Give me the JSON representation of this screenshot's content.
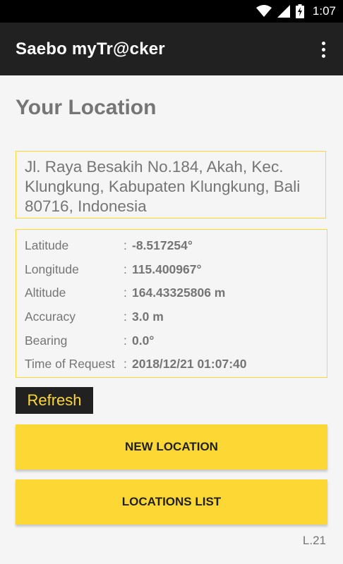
{
  "status_bar": {
    "time": "1:07",
    "icons": [
      "wifi-icon",
      "signal-icon",
      "battery-charging-icon"
    ]
  },
  "app_bar": {
    "title": "Saebo myTr@cker",
    "menu_icon": "overflow-menu-icon"
  },
  "location": {
    "heading": "Your Location",
    "address": "Jl. Raya Besakih No.184, Akah, Kec. Klungkung, Kabupaten Klungkung, Bali 80716, Indonesia",
    "details": [
      {
        "label": "Latitude",
        "value": "-8.517254°"
      },
      {
        "label": "Longitude",
        "value": "115.400967°"
      },
      {
        "label": "Altitude",
        "value": "164.43325806 m"
      },
      {
        "label": "Accuracy",
        "value": "3.0 m"
      },
      {
        "label": "Bearing",
        "value": "0.0°"
      },
      {
        "label": "Time of Request",
        "value": "2018/12/21 01:07:40"
      }
    ],
    "separator": ":"
  },
  "buttons": {
    "refresh": "Refresh",
    "new_location": "NEW LOCATION",
    "locations_list": "LOCATIONS LIST"
  },
  "version": "L.21",
  "colors": {
    "accent": "#fdd835",
    "dark": "#212121",
    "text_gray": "#757575",
    "background": "#f5f5f5"
  }
}
